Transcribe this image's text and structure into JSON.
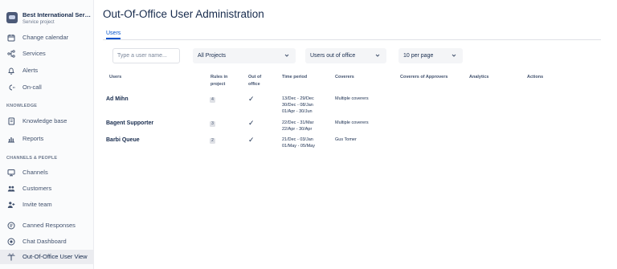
{
  "project": {
    "name": "Best International Service Project",
    "type": "Service project"
  },
  "nav": {
    "items_top": [
      {
        "label": "Change calendar",
        "icon": "calendar-icon"
      },
      {
        "label": "Services",
        "icon": "services-icon"
      },
      {
        "label": "Alerts",
        "icon": "bell-icon"
      },
      {
        "label": "On-call",
        "icon": "on-call-icon"
      }
    ],
    "knowledge_title": "KNOWLEDGE",
    "items_knowledge": [
      {
        "label": "Knowledge base",
        "icon": "book-icon"
      },
      {
        "label": "Reports",
        "icon": "chart-icon"
      }
    ],
    "channels_title": "CHANNELS & PEOPLE",
    "items_channels": [
      {
        "label": "Channels",
        "icon": "monitor-icon"
      },
      {
        "label": "Customers",
        "icon": "people-icon"
      },
      {
        "label": "Invite team",
        "icon": "add-person-icon"
      }
    ],
    "items_bottom": [
      {
        "label": "Canned Responses",
        "icon": "canned-responses-icon"
      },
      {
        "label": "Chat Dashboard",
        "icon": "chat-icon"
      },
      {
        "label": "Out-Of-Office User View",
        "icon": "palm-tree-icon"
      }
    ]
  },
  "page": {
    "title": "Out-Of-Office User Administration"
  },
  "tabs": [
    {
      "label": "Users"
    }
  ],
  "filters": {
    "search_placeholder": "Type a user name...",
    "search_value": "",
    "project": "All Projects",
    "status": "Users out of office",
    "per_page": "10 per page"
  },
  "table": {
    "columns": {
      "users": "Users",
      "rules": "Rules in project",
      "ooo": "Out of office",
      "period": "Time period",
      "coverers": "Coverers",
      "approvers": "Coverers of Approvers",
      "analytics": "Analytics",
      "actions": "Actions"
    },
    "rows": [
      {
        "user": "Ad Mihn",
        "rules": "4",
        "ooo": "✓",
        "periods": [
          "13/Dec - 29/Dec",
          "30/Dec - 08/Jan",
          "01/Apr - 30/Jun"
        ],
        "coverers": "Multiple coverers"
      },
      {
        "user": "Bagent Supporter",
        "rules": "3",
        "ooo": "✓",
        "periods": [
          "22/Dec - 31/Mar",
          "22/Apr - 30/Apr"
        ],
        "coverers": "Multiple coverers"
      },
      {
        "user": "Barbi Queue",
        "rules": "2",
        "ooo": "✓",
        "periods": [
          "21/Dec - 03/Jan",
          "01/May - 05/May"
        ],
        "coverers": "Gus Tomer"
      }
    ]
  },
  "colors": {
    "accent": "#0052cc",
    "text": "#172b4d",
    "sidebar_bg": "#fafbfc"
  }
}
